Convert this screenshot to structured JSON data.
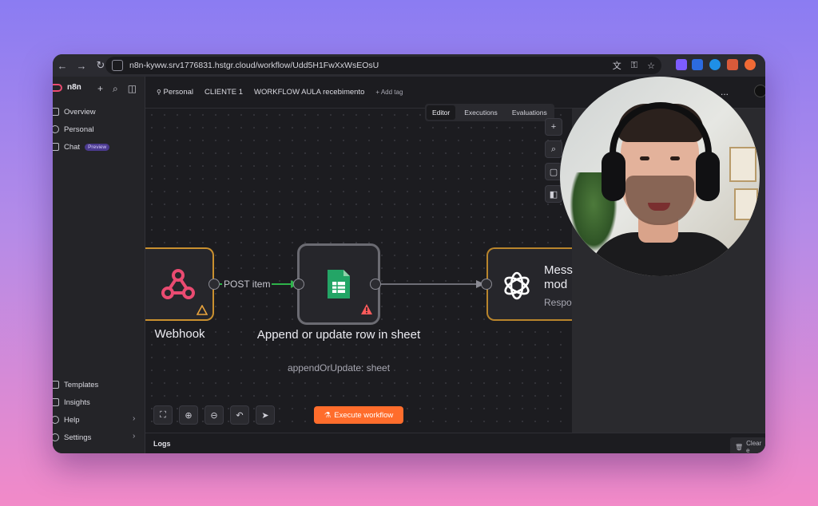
{
  "browser": {
    "url": "n8n-kyww.srv1776831.hstgr.cloud/workflow/Udd5H1FwXxWsEOsU"
  },
  "sidebar": {
    "brand": "n8n",
    "items": [
      {
        "label": "Overview"
      },
      {
        "label": "Personal"
      },
      {
        "label": "Chat",
        "badge": "Preview"
      }
    ],
    "bottom_items": [
      {
        "label": "Templates"
      },
      {
        "label": "Insights"
      },
      {
        "label": "Help"
      },
      {
        "label": "Settings"
      }
    ]
  },
  "header": {
    "crumb_personal": "Personal",
    "crumb_project": "CLIENTE 1",
    "workflow_name": "WORKFLOW AULA recebimento",
    "add_tag": "+ Add tag",
    "more": "..."
  },
  "tabs": [
    {
      "label": "Editor",
      "active": true
    },
    {
      "label": "Executions",
      "active": false
    },
    {
      "label": "Evaluations",
      "active": false
    }
  ],
  "canvas": {
    "nodes": [
      {
        "label": "Webhook",
        "icon": "webhook-icon",
        "warning": true
      },
      {
        "label": "Append or update row in sheet",
        "sub": "appendOrUpdate: sheet",
        "icon": "google-sheets-icon",
        "warning": true
      },
      {
        "label": "Mess",
        "label2": "mod",
        "sub": "Respo",
        "icon": "openai-icon"
      }
    ],
    "edge_label": "POST item",
    "execute_button": "Execute workflow"
  },
  "logs": {
    "label": "Logs",
    "clear": "Clear e"
  },
  "colors": {
    "accent": "#ff6d2c",
    "brand": "#ea4b71",
    "edge_active": "#2eb24a",
    "warning": "#e8a33d",
    "error": "#ff5b5b"
  }
}
